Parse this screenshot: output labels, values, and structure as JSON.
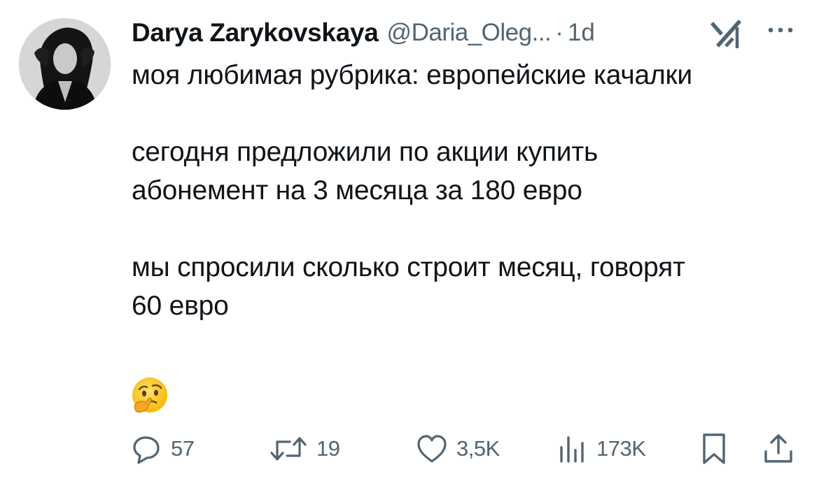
{
  "author": {
    "display_name": "Darya Zarykovskaya",
    "handle": "@Daria_Oleg...",
    "separator": "·",
    "time": "1d"
  },
  "tweet": {
    "paragraphs": [
      "моя любимая рубрика: европейские качалки",
      "сегодня предложили по акции купить\nабонемент на 3 месяца за 180 евро",
      "мы спросили сколько строит месяц, говорят\n60 евро"
    ],
    "emoji": "🤔"
  },
  "metrics": {
    "replies": "57",
    "reposts": "19",
    "likes": "3,5K",
    "views": "173K"
  },
  "icons": {
    "grok": "grok-icon",
    "more": "more-icon",
    "reply": "reply-icon",
    "repost": "repost-icon",
    "like": "heart-icon",
    "views": "views-icon",
    "bookmark": "bookmark-icon",
    "share": "share-icon"
  },
  "colors": {
    "text": "#0f1419",
    "secondary": "#536471",
    "background": "#ffffff"
  }
}
